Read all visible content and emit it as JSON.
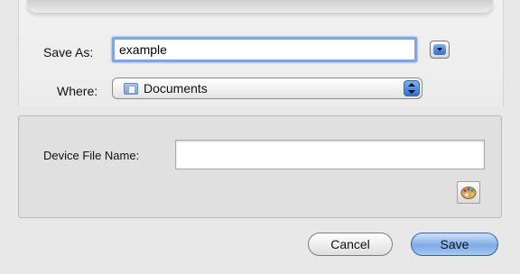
{
  "save_as": {
    "label": "Save As:",
    "value": "example"
  },
  "where": {
    "label": "Where:",
    "value": "Documents",
    "icon": "folder-icon"
  },
  "device": {
    "label": "Device File Name:",
    "value": ""
  },
  "buttons": {
    "cancel": "Cancel",
    "save": "Save"
  },
  "colors": {
    "accent": "#7eaae6",
    "focus": "#7fa8e0"
  }
}
